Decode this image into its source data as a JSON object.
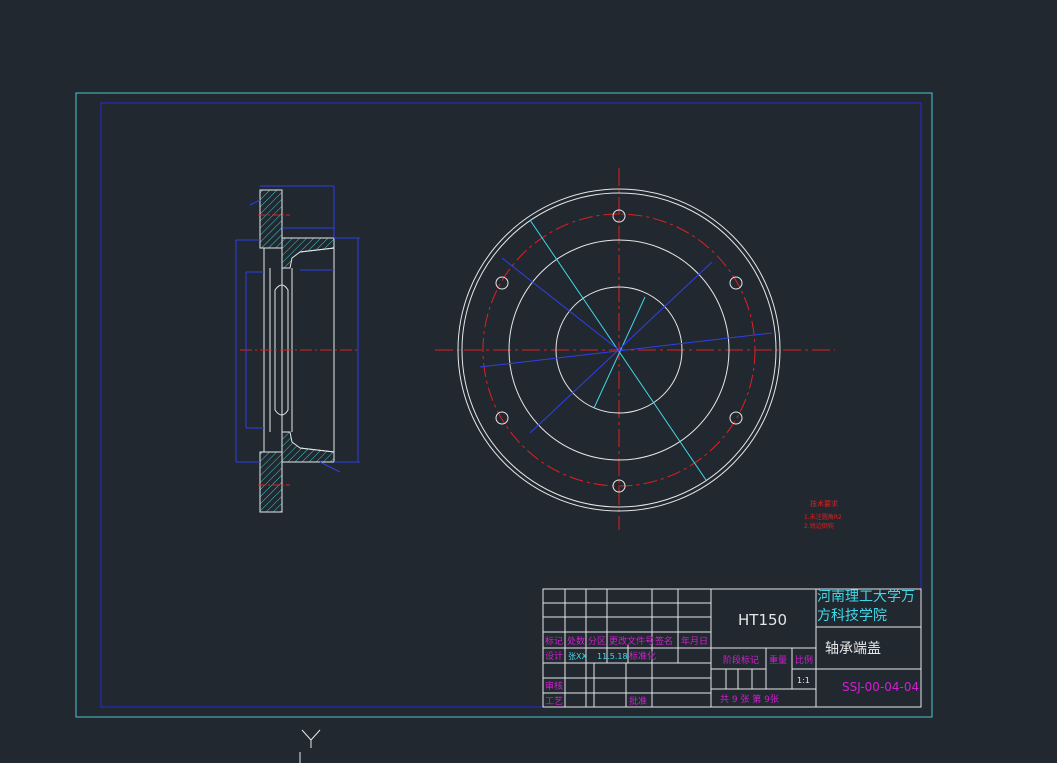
{
  "drawing": {
    "material": "HT150",
    "school_line1": "河南理工大学万",
    "school_line2": "方科技学院",
    "part_name": "轴承端盖",
    "drawing_no": "SSJ-00-04-04",
    "scale": "1:1",
    "sheets": "共 9 张 第 9张"
  },
  "title_block": {
    "hdr_mark": "标记",
    "hdr_count": "处数",
    "hdr_zone": "分区",
    "hdr_docno": "更改文件号",
    "hdr_sign": "签名",
    "hdr_date": "年月日",
    "design": "设计",
    "designer": "张XX",
    "design_date": "11.5.18",
    "standardize": "标准化",
    "stage_mark": "阶段标记",
    "weight": "重量",
    "scale_label": "比例",
    "review": "审核",
    "process": "工艺",
    "approve": "批准"
  },
  "tech_req": {
    "title": "技术要求",
    "line1": "1.未注圆角R2",
    "line2": "2.锐边倒钝"
  },
  "ucs": {
    "axis_label": "Y"
  },
  "colors": {
    "background": "#212830",
    "outer_frame": "#4fc3d0",
    "inner_frame": "#2a2ad8",
    "geometry": "#e6e6e6",
    "hatch": "#40c8c8",
    "dimension": "#3040e8",
    "centerline": "#e02020",
    "tech_req": "#e02020",
    "title_text": "#d020d0",
    "school_text": "#40d8e8"
  }
}
